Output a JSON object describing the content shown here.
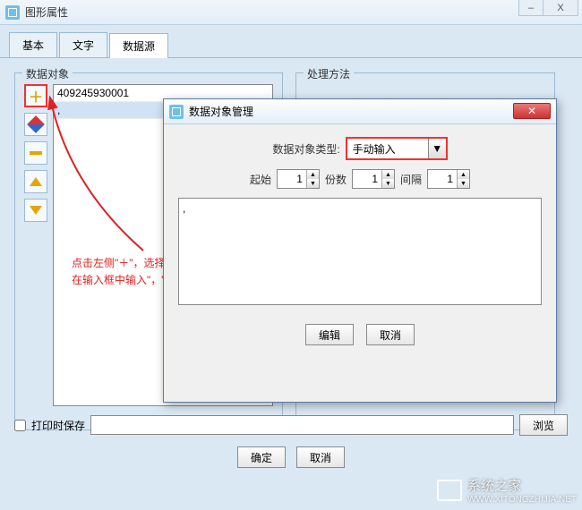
{
  "window": {
    "title": "图形属性",
    "minimize": "–",
    "close": "X"
  },
  "tabs": [
    {
      "label": "基本",
      "active": false
    },
    {
      "label": "文字",
      "active": false
    },
    {
      "label": "数据源",
      "active": true
    }
  ],
  "fieldsets": {
    "data_objects": "数据对象",
    "processing": "处理方法"
  },
  "toolbar": {
    "add": "＋",
    "edit": "✎",
    "remove": "—",
    "up": "▲",
    "down": "▼"
  },
  "list": {
    "items": [
      {
        "text": "409245930001",
        "selected": false
      },
      {
        "text": ",",
        "selected": true
      }
    ]
  },
  "bottom": {
    "print_save_label": "打印时保存",
    "path_value": "",
    "browse": "浏览"
  },
  "dialog_buttons": {
    "ok": "确定",
    "cancel": "取消"
  },
  "modal": {
    "title": "数据对象管理",
    "type_label": "数据对象类型:",
    "type_value": "手动输入",
    "start_label": "起始",
    "start_value": "1",
    "copies_label": "份数",
    "copies_value": "1",
    "interval_label": "间隔",
    "interval_value": "1",
    "text_value": ",",
    "edit": "编辑",
    "cancel": "取消"
  },
  "annotation": {
    "line1": "点击左侧\"＋\"，选择手动输入，",
    "line2": "在输入框中输入\"，\"（半角逗号）"
  },
  "watermark": {
    "name": "系统之家",
    "url": "WWW.XITONGZHIJIA.NET"
  }
}
